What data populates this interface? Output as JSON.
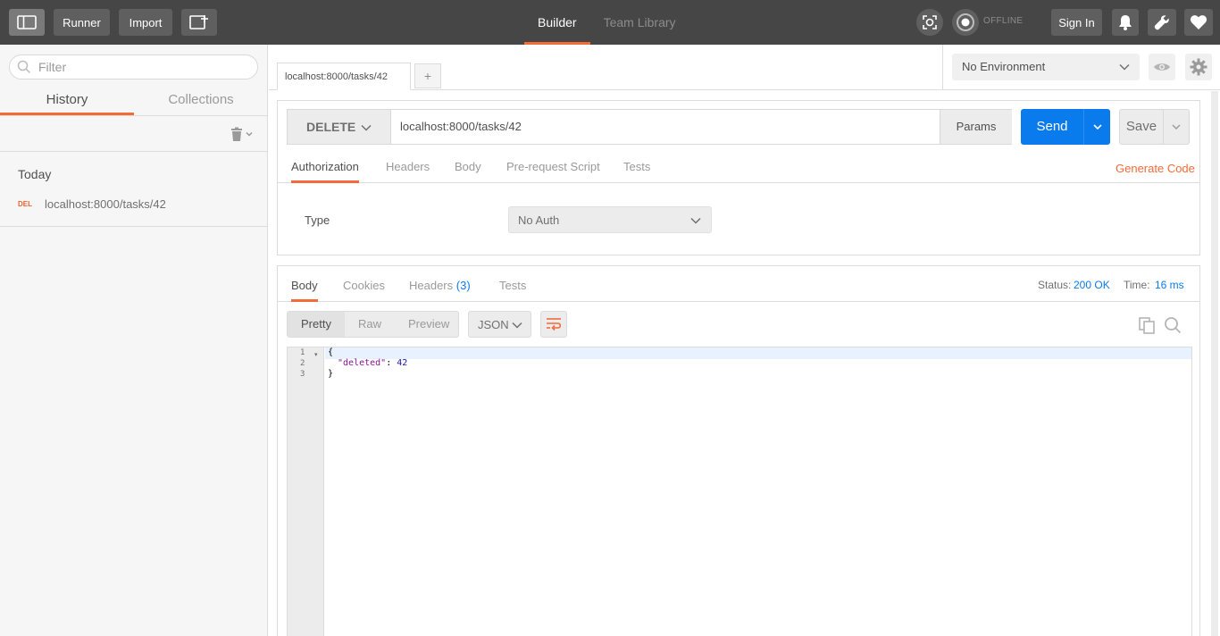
{
  "header": {
    "runner_label": "Runner",
    "import_label": "Import",
    "tabs": [
      {
        "label": "Builder",
        "active": true
      },
      {
        "label": "Team Library",
        "active": false
      }
    ],
    "offline_label": "OFFLINE",
    "signin_label": "Sign In",
    "icons": [
      "sidebar-toggle-icon",
      "new-tab-icon",
      "sync-icon",
      "interceptor-icon",
      "bell-icon",
      "wrench-icon",
      "heart-icon"
    ]
  },
  "sidebar": {
    "filter_placeholder": "Filter",
    "tabs": [
      {
        "label": "History",
        "active": true
      },
      {
        "label": "Collections",
        "active": false
      }
    ],
    "group_label": "Today",
    "history": [
      {
        "method": "DEL",
        "url": "localhost:8000/tasks/42"
      }
    ]
  },
  "request_tabs": {
    "active_tab": "localhost:8000/tasks/42",
    "add_label": "+"
  },
  "environment": {
    "selected": "No Environment"
  },
  "request": {
    "method": "DELETE",
    "url": "localhost:8000/tasks/42",
    "params_label": "Params",
    "send_label": "Send",
    "save_label": "Save",
    "tabs": [
      {
        "label": "Authorization",
        "active": true
      },
      {
        "label": "Headers",
        "active": false
      },
      {
        "label": "Body",
        "active": false
      },
      {
        "label": "Pre-request Script",
        "active": false
      },
      {
        "label": "Tests",
        "active": false
      }
    ],
    "generate_code_label": "Generate Code",
    "auth_type_label": "Type",
    "auth_type_value": "No Auth"
  },
  "response": {
    "tabs": [
      {
        "label": "Body",
        "active": true
      },
      {
        "label": "Cookies",
        "active": false
      },
      {
        "label": "Headers",
        "count": "(3)",
        "active": false
      },
      {
        "label": "Tests",
        "active": false
      }
    ],
    "status_label": "Status:",
    "status_value": "200 OK",
    "time_label": "Time:",
    "time_value": "16 ms",
    "view_modes": [
      {
        "label": "Pretty",
        "active": true
      },
      {
        "label": "Raw",
        "active": false
      },
      {
        "label": "Preview",
        "active": false
      }
    ],
    "format": "JSON",
    "line_numbers": [
      "1",
      "2",
      "3"
    ],
    "body": {
      "open_brace": "{",
      "key": "\"deleted\"",
      "colon": ": ",
      "value": "42",
      "close_brace": "}"
    }
  },
  "colors": {
    "accent": "#f26b3a",
    "primary": "#097bed",
    "header_bg": "#464646"
  }
}
